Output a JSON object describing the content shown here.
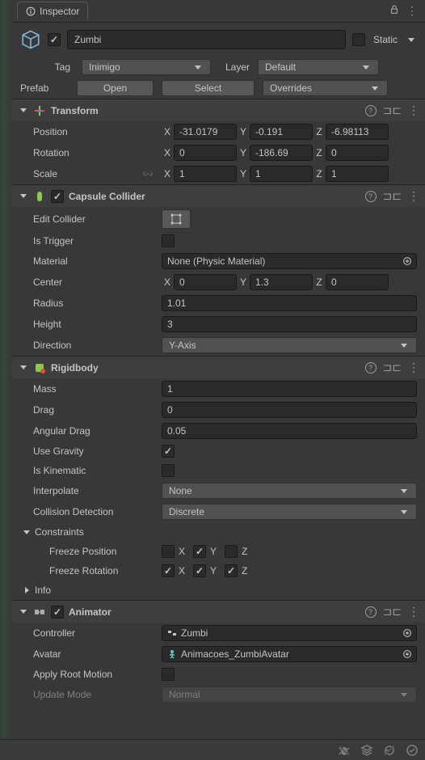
{
  "tab": {
    "title": "Inspector"
  },
  "header": {
    "active": true,
    "name": "Zumbi",
    "static": false,
    "static_label": "Static",
    "tag_label": "Tag",
    "tag_value": "Inimigo",
    "layer_label": "Layer",
    "layer_value": "Default",
    "prefab_label": "Prefab",
    "open_btn": "Open",
    "select_btn": "Select",
    "overrides_btn": "Overrides"
  },
  "transform": {
    "title": "Transform",
    "position_label": "Position",
    "position": {
      "x": "-31.0179",
      "y": "-0.191",
      "z": "-6.98113"
    },
    "rotation_label": "Rotation",
    "rotation": {
      "x": "0",
      "y": "-186.69",
      "z": "0"
    },
    "scale_label": "Scale",
    "scale": {
      "x": "1",
      "y": "1",
      "z": "1"
    }
  },
  "capsule": {
    "title": "Capsule Collider",
    "enabled": true,
    "edit_label": "Edit Collider",
    "trigger_label": "Is Trigger",
    "trigger": false,
    "material_label": "Material",
    "material_value": "None (Physic Material)",
    "center_label": "Center",
    "center": {
      "x": "0",
      "y": "1.3",
      "z": "0"
    },
    "radius_label": "Radius",
    "radius": "1.01",
    "height_label": "Height",
    "height": "3",
    "direction_label": "Direction",
    "direction": "Y-Axis"
  },
  "rigidbody": {
    "title": "Rigidbody",
    "mass_label": "Mass",
    "mass": "1",
    "drag_label": "Drag",
    "drag": "0",
    "ang_drag_label": "Angular Drag",
    "ang_drag": "0.05",
    "gravity_label": "Use Gravity",
    "gravity": true,
    "kinematic_label": "Is Kinematic",
    "kinematic": false,
    "interpolate_label": "Interpolate",
    "interpolate": "None",
    "collision_label": "Collision Detection",
    "collision": "Discrete",
    "constraints_label": "Constraints",
    "freeze_pos_label": "Freeze Position",
    "freeze_pos": {
      "x": false,
      "y": true,
      "z": false
    },
    "freeze_rot_label": "Freeze Rotation",
    "freeze_rot": {
      "x": true,
      "y": true,
      "z": true
    },
    "info_label": "Info"
  },
  "animator": {
    "title": "Animator",
    "enabled": true,
    "controller_label": "Controller",
    "controller_value": "Zumbi",
    "avatar_label": "Avatar",
    "avatar_value": "Animacoes_ZumbiAvatar",
    "root_motion_label": "Apply Root Motion",
    "root_motion": false,
    "update_mode_label": "Update Mode",
    "update_mode": "Normal"
  },
  "axes": {
    "x": "X",
    "y": "Y",
    "z": "Z"
  }
}
